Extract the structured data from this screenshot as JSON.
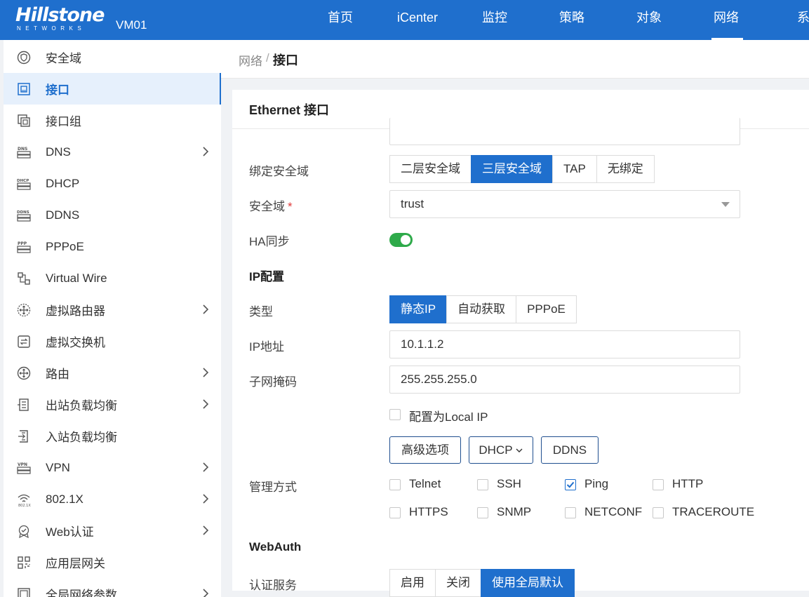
{
  "header": {
    "logo_text": "Hillstone",
    "logo_sub": "NETWORKS",
    "device": "VM01",
    "nav": [
      "首页",
      "iCenter",
      "监控",
      "策略",
      "对象",
      "网络",
      "系"
    ],
    "active_nav": "网络"
  },
  "sidebar": {
    "items": [
      {
        "label": "安全域",
        "icon": "shield-icon"
      },
      {
        "label": "接口",
        "icon": "interface-icon",
        "active": true
      },
      {
        "label": "接口组",
        "icon": "interface-group-icon"
      },
      {
        "label": "DNS",
        "icon": "dns-icon",
        "expandable": true
      },
      {
        "label": "DHCP",
        "icon": "dhcp-icon"
      },
      {
        "label": "DDNS",
        "icon": "ddns-icon"
      },
      {
        "label": "PPPoE",
        "icon": "pppoe-icon"
      },
      {
        "label": "Virtual Wire",
        "icon": "virtual-wire-icon"
      },
      {
        "label": "虚拟路由器",
        "icon": "virtual-router-icon",
        "expandable": true
      },
      {
        "label": "虚拟交换机",
        "icon": "virtual-switch-icon"
      },
      {
        "label": "路由",
        "icon": "route-icon",
        "expandable": true
      },
      {
        "label": "出站负载均衡",
        "icon": "outbound-lb-icon",
        "expandable": true
      },
      {
        "label": "入站负载均衡",
        "icon": "inbound-lb-icon"
      },
      {
        "label": "VPN",
        "icon": "vpn-icon",
        "expandable": true
      },
      {
        "label": "802.1X",
        "icon": "wireless-8021x-icon",
        "expandable": true
      },
      {
        "label": "Web认证",
        "icon": "web-auth-icon",
        "expandable": true
      },
      {
        "label": "应用层网关",
        "icon": "app-gateway-icon"
      },
      {
        "label": "全局网络参数",
        "icon": "global-params-icon",
        "expandable": true
      }
    ]
  },
  "breadcrumb": {
    "parent": "网络",
    "separator": "/",
    "current": "接口"
  },
  "panel": {
    "title": "Ethernet 接口",
    "bind_zone": {
      "label": "绑定安全域",
      "options": [
        "二层安全域",
        "三层安全域",
        "TAP",
        "无绑定"
      ],
      "selected": "三层安全域"
    },
    "zone": {
      "label": "安全域",
      "required_mark": "*",
      "value": "trust"
    },
    "ha_sync": {
      "label": "HA同步",
      "enabled": true
    },
    "ip_section": "IP配置",
    "type": {
      "label": "类型",
      "options": [
        "静态IP",
        "自动获取",
        "PPPoE"
      ],
      "selected": "静态IP"
    },
    "ip_address": {
      "label": "IP地址",
      "value": "10.1.1.2"
    },
    "netmask": {
      "label": "子网掩码",
      "value": "255.255.255.0"
    },
    "local_ip": {
      "label": "配置为Local IP",
      "checked": false
    },
    "buttons": {
      "advanced": "高级选项",
      "dhcp": "DHCP",
      "ddns": "DDNS"
    },
    "management": {
      "label": "管理方式",
      "options": [
        {
          "name": "Telnet",
          "checked": false
        },
        {
          "name": "SSH",
          "checked": false
        },
        {
          "name": "Ping",
          "checked": true
        },
        {
          "name": "HTTP",
          "checked": false
        },
        {
          "name": "HTTPS",
          "checked": false
        },
        {
          "name": "SNMP",
          "checked": false
        },
        {
          "name": "NETCONF",
          "checked": false
        },
        {
          "name": "TRACEROUTE",
          "checked": false
        }
      ]
    },
    "webauth_section": "WebAuth",
    "auth_service": {
      "label": "认证服务",
      "options": [
        "启用",
        "关闭",
        "使用全局默认"
      ],
      "selected": "使用全局默认"
    }
  },
  "colors": {
    "primary": "#1f6fcd",
    "toggle_on": "#2eaa4a",
    "required": "#e03a3a"
  }
}
